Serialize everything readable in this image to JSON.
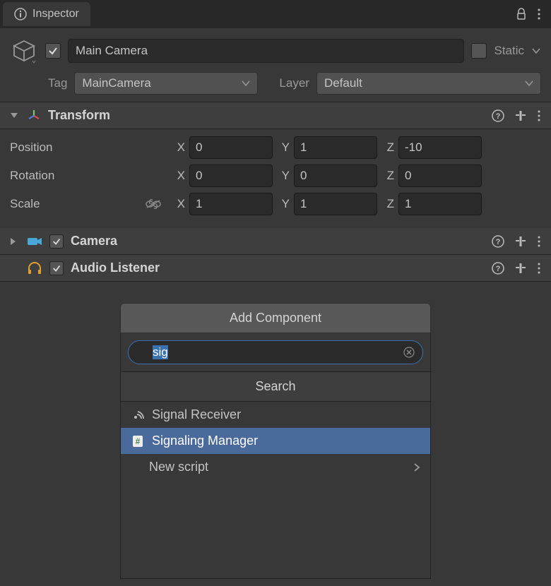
{
  "tab": {
    "title": "Inspector"
  },
  "header": {
    "name": "Main Camera",
    "static_label": "Static",
    "tag_label": "Tag",
    "tag_value": "MainCamera",
    "layer_label": "Layer",
    "layer_value": "Default",
    "active": true,
    "static": false
  },
  "components": {
    "transform": {
      "title": "Transform",
      "position": {
        "label": "Position",
        "x": "0",
        "y": "1",
        "z": "-10"
      },
      "rotation": {
        "label": "Rotation",
        "x": "0",
        "y": "0",
        "z": "0"
      },
      "scale": {
        "label": "Scale",
        "x": "1",
        "y": "1",
        "z": "1"
      }
    },
    "camera": {
      "title": "Camera",
      "enabled": true
    },
    "audio_listener": {
      "title": "Audio Listener",
      "enabled": true
    }
  },
  "axes": {
    "x": "X",
    "y": "Y",
    "z": "Z"
  },
  "add_component": {
    "button_label": "Add Component",
    "search_value": "sig",
    "search_header": "Search",
    "results": [
      {
        "label": "Signal Receiver",
        "icon": "signal",
        "selected": false
      },
      {
        "label": "Signaling Manager",
        "icon": "script",
        "selected": true
      },
      {
        "label": "New script",
        "icon": null,
        "selected": false,
        "submenu": true
      }
    ]
  }
}
